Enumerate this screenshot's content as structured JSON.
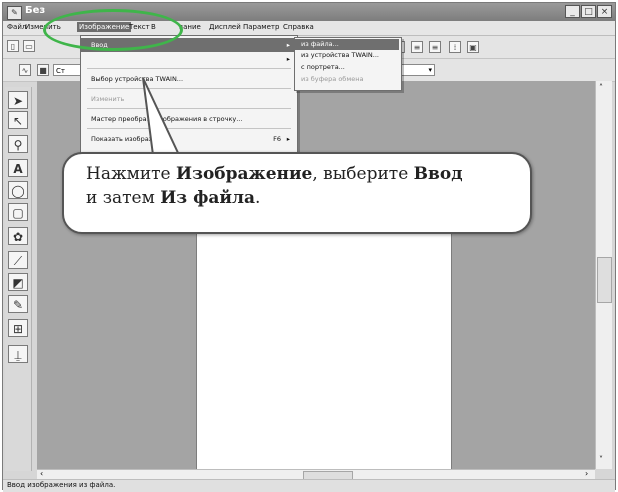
{
  "window": {
    "title": "Без",
    "controls": [
      "_",
      "□",
      "×"
    ]
  },
  "menubar": [
    "Файл",
    "Изменить",
    "Изображение",
    "Текст",
    "В",
    "вание",
    "Дисплей",
    "Параметр",
    "Справка"
  ],
  "image_menu": {
    "items": [
      {
        "label": "Ввод",
        "arrow": "▸"
      },
      {
        "label": "",
        "arrow": "▸"
      },
      {
        "label": "Выбор устройства TWAIN..."
      },
      {
        "label": "Изменить"
      },
      {
        "label": "Мастер преобра…        изображения в строчку..."
      },
      {
        "label": "Показать изображ…",
        "key": "F6",
        "arrow": "▸"
      }
    ]
  },
  "input_submenu": {
    "items": [
      "из файла...",
      "из устройства TWAIN...",
      "с портрета...",
      "из буфера обмена"
    ]
  },
  "toolbar": {
    "combo_prefix": "Ст",
    "combo2_value": ""
  },
  "left_tools": [
    "select-arrow-icon",
    "point-edit-icon",
    "zoom-icon",
    "text-tool-icon",
    "shape-tool-icon",
    "rect-tool-icon",
    "outline-tool-icon",
    "stitch-tool-icon",
    "fill-tool-icon",
    "pen-tool-icon",
    "ruler-icon",
    "stamp-icon"
  ],
  "callout": {
    "prefix": "Нажмите ",
    "b1": "Изображение",
    "mid1": ", выберите ",
    "b2": "Ввод",
    "line2_prefix": "и затем ",
    "b3": "Из файла",
    "suffix": "."
  },
  "statusbar": {
    "text": "Ввод изображения из файла."
  },
  "colors": {
    "highlight_ellipse": "#3fb54a"
  }
}
